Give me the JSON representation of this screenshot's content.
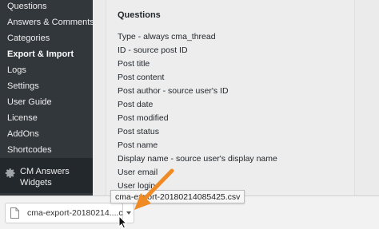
{
  "sidebar": {
    "items": [
      {
        "label": "Questions"
      },
      {
        "label": "Answers & Comments"
      },
      {
        "label": "Categories"
      },
      {
        "label": "Export & Import"
      },
      {
        "label": "Logs"
      },
      {
        "label": "Settings"
      },
      {
        "label": "User Guide"
      },
      {
        "label": "License"
      },
      {
        "label": "AddOns"
      },
      {
        "label": "Shortcodes"
      }
    ],
    "plugin": {
      "line1": "CM Answers",
      "line2": "Widgets",
      "icon": "gear-icon"
    }
  },
  "main": {
    "title": "Questions",
    "fields": [
      "Type - always cma_thread",
      "ID - source post ID",
      "Post title",
      "Post content",
      "Post author - source user's ID",
      "Post date",
      "Post modified",
      "Post status",
      "Post name",
      "Display name - source user's display name",
      "User email",
      "User login"
    ]
  },
  "download": {
    "file_label": "cma-export-20180214....csv",
    "tooltip": "cma-export-20180214085425.csv",
    "file_icon": "file-icon",
    "dropdown_icon": "caret-down-icon"
  },
  "colors": {
    "sidebar_bg": "#32373c",
    "arrow": "#f08a24"
  }
}
